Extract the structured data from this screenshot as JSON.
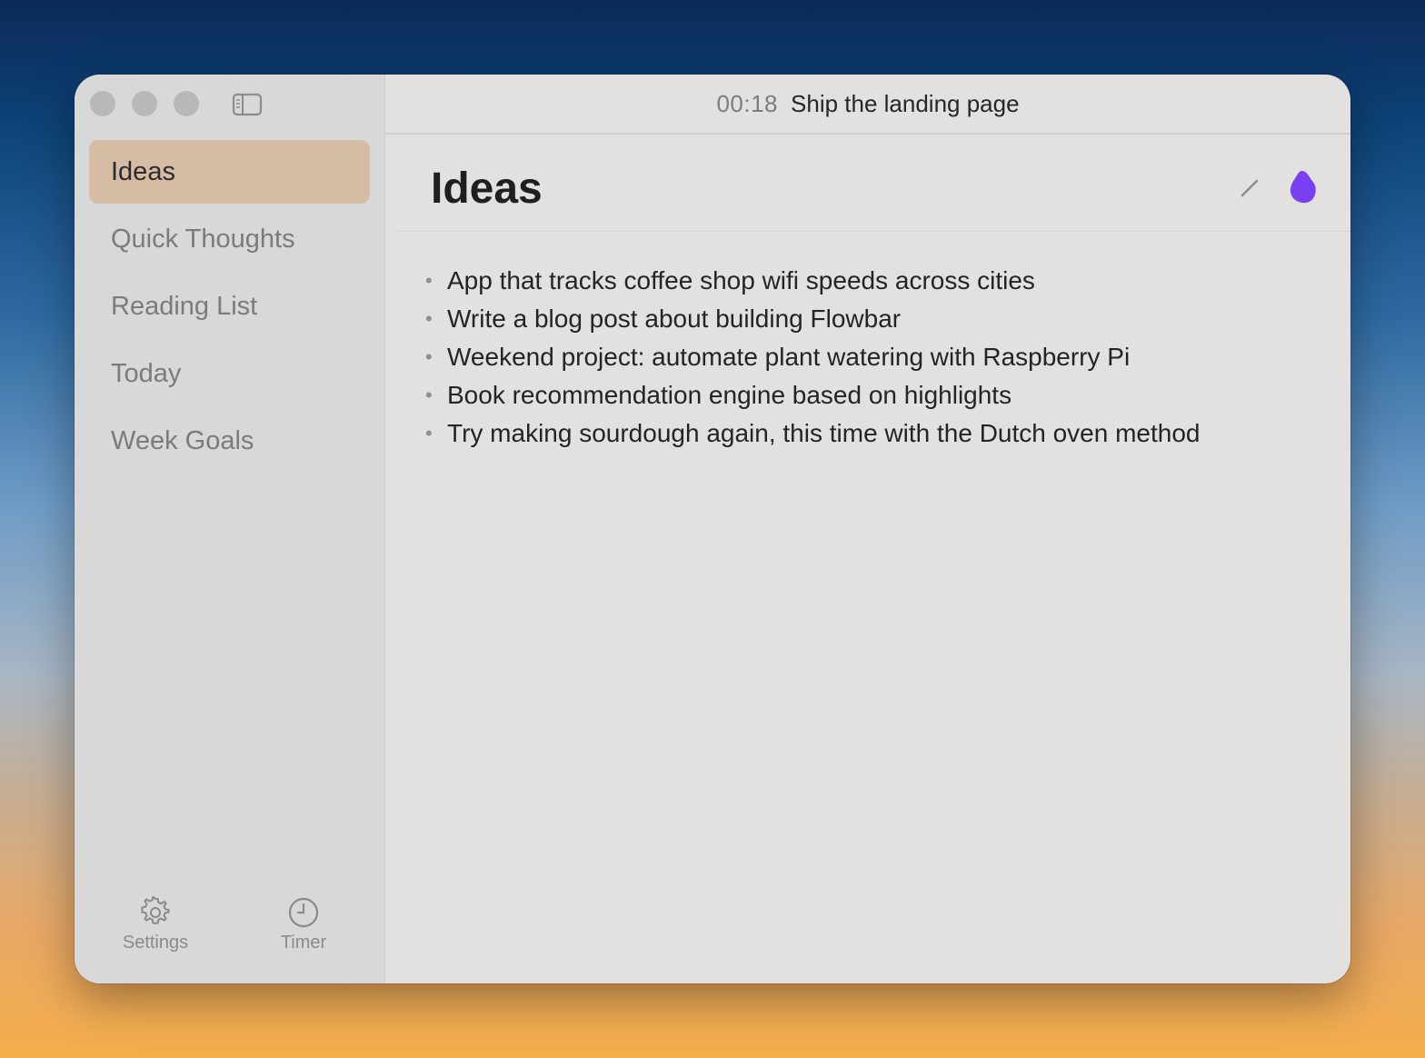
{
  "window": {
    "header": {
      "timer": "00:18",
      "task": "Ship the landing page"
    }
  },
  "sidebar": {
    "items": [
      {
        "label": "Ideas",
        "active": true
      },
      {
        "label": "Quick Thoughts",
        "active": false
      },
      {
        "label": "Reading List",
        "active": false
      },
      {
        "label": "Today",
        "active": false
      },
      {
        "label": "Week Goals",
        "active": false
      }
    ],
    "footer": {
      "settings_label": "Settings",
      "timer_label": "Timer"
    }
  },
  "document": {
    "title": "Ideas",
    "items": [
      "App that tracks coffee shop wifi speeds across cities",
      "Write a blog post about building Flowbar",
      "Weekend project: automate plant watering with Raspberry Pi",
      "Book recommendation engine based on highlights",
      "Try making sourdough again, this time with the Dutch oven method"
    ]
  },
  "icons": {
    "settings": "gear-icon",
    "timer": "clock-icon",
    "edit": "pencil-icon",
    "color": "blob-icon",
    "sidebar_toggle": "sidebar-toggle-icon"
  },
  "colors": {
    "active_item_bg": "#d6bca5",
    "accent_blob": "#7b3ff2"
  }
}
